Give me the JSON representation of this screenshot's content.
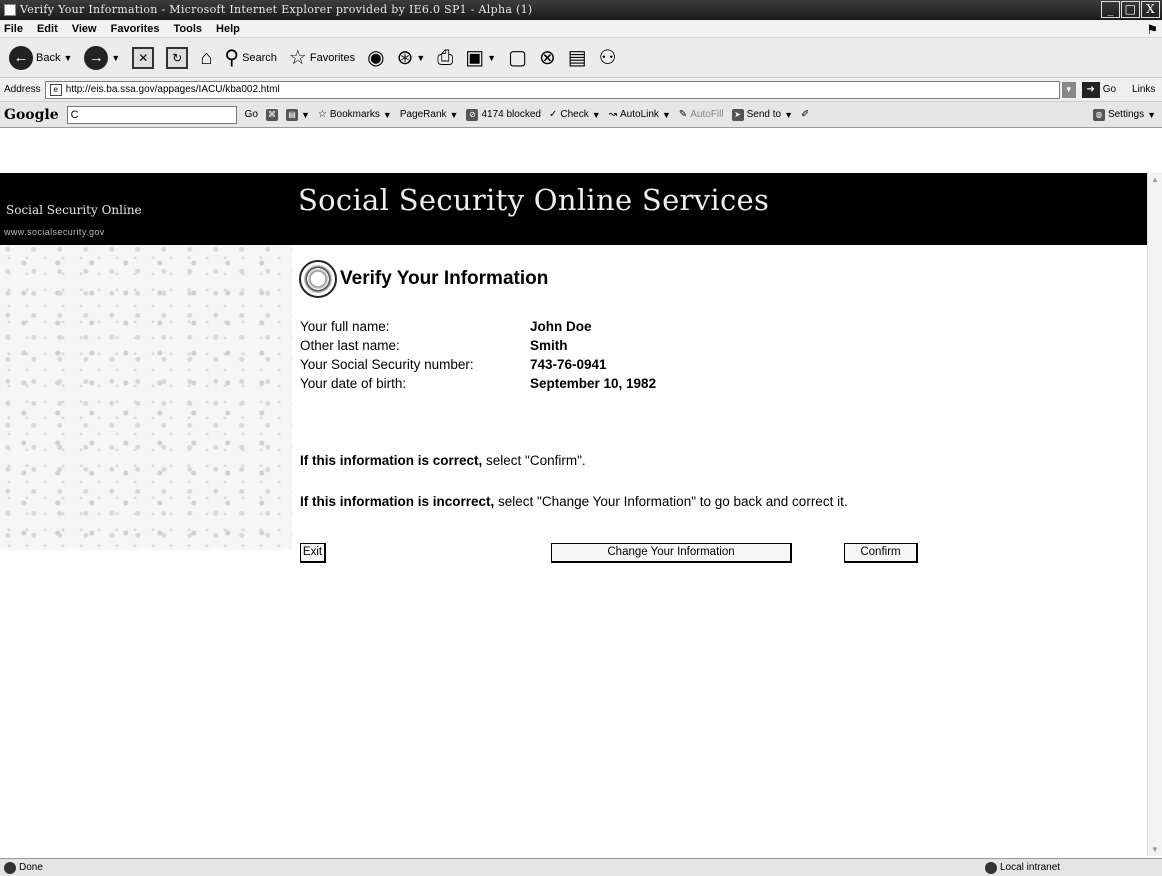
{
  "window": {
    "title": "Verify Your Information - Microsoft Internet Explorer provided by IE6.0 SP1 - Alpha (1)",
    "controls": [
      "_",
      "□",
      "X"
    ]
  },
  "menu": [
    "File",
    "Edit",
    "View",
    "Favorites",
    "Tools",
    "Help"
  ],
  "toolbar": {
    "back_label": "Back",
    "search_label": "Search",
    "favorites_label": "Favorites"
  },
  "address": {
    "label": "Address",
    "url": "http://eis.ba.ssa.gov/appages/IACU/kba002.html",
    "go_label": "Go",
    "links_label": "Links"
  },
  "googlebar": {
    "logo": "Google",
    "query": "C",
    "go_label": "Go",
    "bookmarks_label": "Bookmarks",
    "pagerank_label": "PageRank",
    "blocked_label": "4174 blocked",
    "check_label": "Check",
    "autolink_label": "AutoLink",
    "autofill_label": "AutoFill",
    "sendto_label": "Send to",
    "settings_label": "Settings"
  },
  "banner": {
    "site_name": "Social Security Online",
    "site_url": "www.socialsecurity.gov",
    "title": "Social Security Online Services"
  },
  "page": {
    "heading": "Verify Your Information",
    "fields": [
      {
        "label": "Your full name:",
        "value": "John Doe"
      },
      {
        "label": "Other last name:",
        "value": "Smith"
      },
      {
        "label": "Your Social Security number:",
        "value": "743-76-0941"
      },
      {
        "label": "Your date of birth:",
        "value": "September 10, 1982"
      }
    ],
    "correct_bold": "If this information is correct,",
    "correct_rest": " select \"Confirm\".",
    "incorrect_bold": "If this information is incorrect,",
    "incorrect_rest": " select \"Change Your Information\" to go back and correct it.",
    "buttons": {
      "exit": "Exit",
      "change": "Change Your Information",
      "confirm": "Confirm"
    }
  },
  "status": {
    "left": "Done",
    "zone": "Local intranet"
  }
}
